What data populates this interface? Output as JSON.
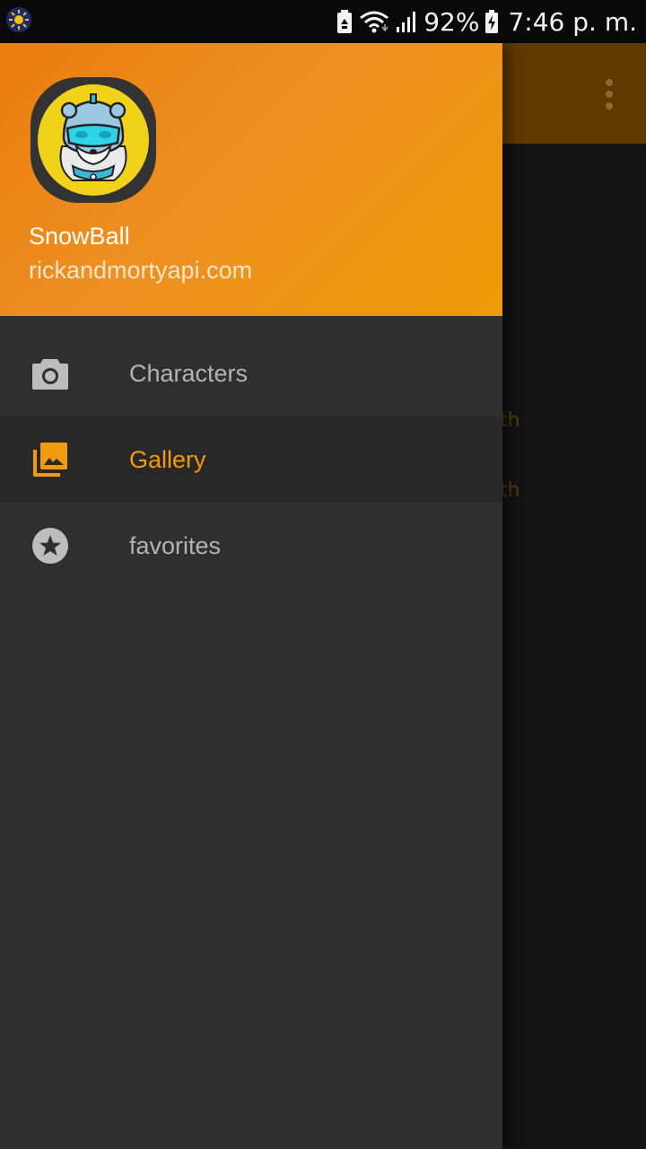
{
  "status_bar": {
    "battery_percent": "92%",
    "time": "7:46 p. m.",
    "icons": [
      "weather-sun-icon",
      "battery-saver-icon",
      "wifi-icon",
      "signal-icon",
      "battery-charging-icon"
    ]
  },
  "background_screen": {
    "overflow_icon": "more-vert-icon",
    "partial_text_1": "th",
    "partial_text_2": "th"
  },
  "drawer": {
    "header": {
      "name": "SnowBall",
      "email": "rickandmortyapi.com",
      "avatar": "yeti-mascot-avatar"
    },
    "items": [
      {
        "label": "Characters",
        "icon": "camera-icon",
        "active": false
      },
      {
        "label": "Gallery",
        "icon": "photo-library-icon",
        "active": true
      },
      {
        "label": "favorites",
        "icon": "star-circle-icon",
        "active": false
      }
    ]
  },
  "colors": {
    "header_orange": "#ED8A1A",
    "accent": "#F19A10",
    "drawer_bg": "#2F2F2F",
    "active_row_bg": "#282828",
    "inactive_text": "#B3B3B3",
    "icon_gray": "#BDBDBD",
    "toolbar_dimmed": "#5F3900"
  }
}
